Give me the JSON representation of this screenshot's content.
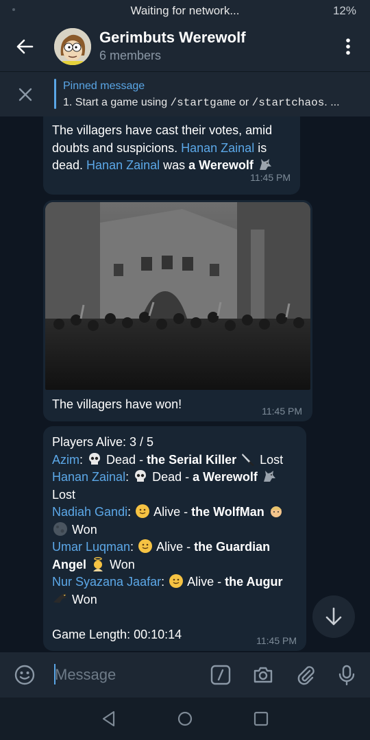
{
  "status_bar": {
    "network_text": "Waiting for network...",
    "battery": "12%"
  },
  "header": {
    "title": "Gerimbuts Werewolf",
    "subtitle": "6 members"
  },
  "pinned": {
    "label": "Pinned message",
    "text_prefix": "1. Start a game using ",
    "cmd1": "/startgame",
    "text_mid": " or ",
    "cmd2": "/startchaos",
    "text_suffix": ". ..."
  },
  "messages": {
    "m1": {
      "t1": "The villagers have cast their votes, amid doubts and suspicions. ",
      "name1": "Hanan Zainal",
      "t2": " is dead. ",
      "name2": "Hanan Zainal",
      "t3": " was ",
      "role": "a Werewolf",
      "emoji": "wolf",
      "time": "11:45 PM"
    },
    "m2": {
      "caption": "The villagers have won!",
      "time": "11:45 PM"
    },
    "m3": {
      "players_alive": "Players Alive: 3 / 5",
      "players": [
        {
          "name": "Azim",
          "status_emoji": "skull",
          "status": "Dead",
          "role": "the Serial Killer",
          "role_emoji": "knife",
          "result": "Lost"
        },
        {
          "name": "Hanan Zainal",
          "status_emoji": "skull",
          "status": "Dead",
          "role": "a Werewolf",
          "role_emoji": "wolf",
          "result": "Lost"
        },
        {
          "name": "Nadiah Gandi",
          "status_emoji": "smile",
          "status": "Alive",
          "role": "the WolfMan",
          "role_emoji": "man + moon",
          "result": "Won"
        },
        {
          "name": "Umar Luqman",
          "status_emoji": "smile",
          "status": "Alive",
          "role": "the Guardian Angel",
          "role_emoji": "angel",
          "result": "Won"
        },
        {
          "name": "Nur Syazana Jaafar",
          "status_emoji": "smile",
          "status": "Alive",
          "role": "the Augur",
          "role_emoji": "eagle",
          "result": "Won"
        }
      ],
      "sep": " - ",
      "game_length": "Game Length: 00:10:14",
      "time": "11:45 PM"
    }
  },
  "input": {
    "placeholder": "Message"
  },
  "colors": {
    "accent": "#5aa6e6",
    "link": "#5ca8e8",
    "bubble": "#182533",
    "background": "#0e1621",
    "header": "#1d2733"
  }
}
